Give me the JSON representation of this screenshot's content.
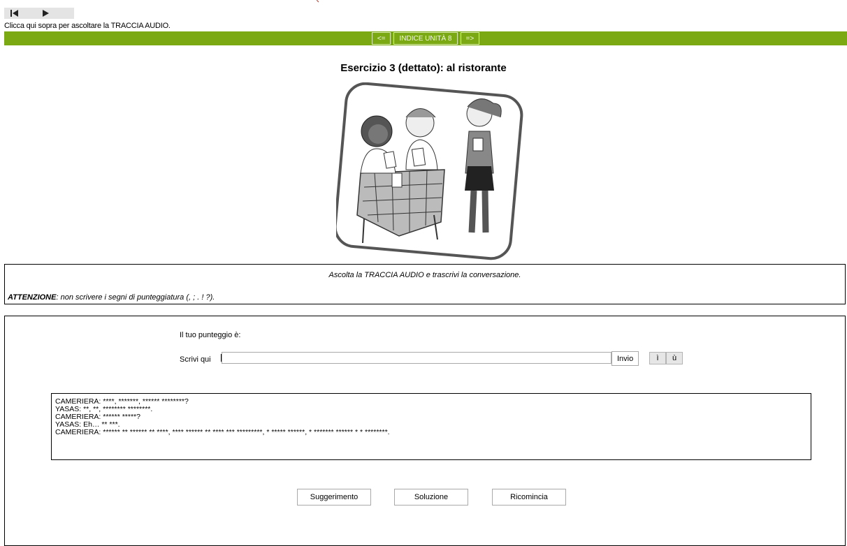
{
  "audio": {
    "hint": "Clicca qui sopra per ascoltare la TRACCIA AUDIO.",
    "controls": [
      "rewind-icon",
      "play-icon"
    ]
  },
  "nav": {
    "prev": "<=",
    "index": "INDICE UNITÀ 8",
    "next": "=>",
    "color": "#7aa914"
  },
  "title": "Esercizio 3 (dettato): al ristorante",
  "instructions": {
    "line1": "Ascolta la TRACCIA AUDIO e trascrivi la conversazione.",
    "line2_bold": "ATTENZIONE",
    "line2_rest": ": non scrivere i segni di punteggiatura (, ; . ! ?)."
  },
  "exercise": {
    "score_label": "Il tuo punteggio è:",
    "write_label": "Scrivi qui",
    "input_value": "",
    "submit_label": "Invio",
    "special_chars": [
      "ì",
      "ù"
    ],
    "dialogue": [
      "CAMERIERA: ****, *******, ****** ********?",
      "YASAS: **, **, ******** ********.",
      "CAMERIERA: ****** *****?",
      "YASAS: Eh… ** ***.",
      "CAMERIERA: ****** ** ****** ** ****, **** ****** ** **** *** *********, * ***** ******, * ******* ****** * * ********."
    ],
    "buttons": {
      "hint": "Suggerimento",
      "solution": "Soluzione",
      "restart": "Ricomincia"
    }
  }
}
